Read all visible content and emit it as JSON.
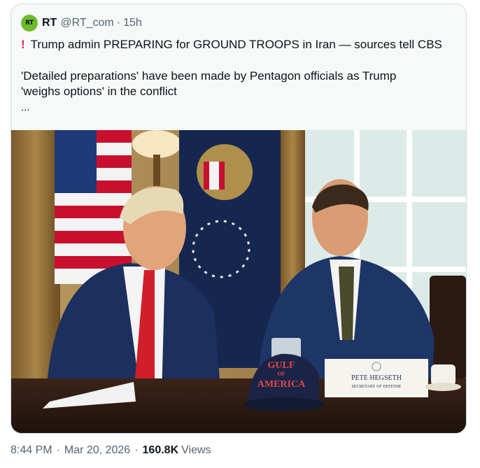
{
  "tweet": {
    "avatar_text": "RT",
    "display_name": "RT",
    "handle": "@RT_com",
    "separator": "·",
    "time_ago": "15h",
    "headline_icon": "exclamation-icon",
    "headline_bang": "!",
    "headline": "Trump admin PREPARING for GROUND TROOPS in Iran — sources tell CBS",
    "body_line1": "'Detailed preparations' have been made by Pentagon officials as Trump",
    "body_line2": "'weighs options' in the conflict",
    "ellipsis": "...",
    "photo": {
      "hat_text_line1": "GULF",
      "hat_text_line2": "OF",
      "hat_text_line3": "AMERICA",
      "placard_name": "PETE HEGSETH",
      "placard_title": "SECRETARY OF DEFENSE"
    }
  },
  "meta": {
    "time": "8:44 PM",
    "separator": "·",
    "date": "Mar 20, 2026",
    "views_count": "160.8K",
    "views_label": "Views"
  },
  "colors": {
    "avatar_green": "#6bbd2b",
    "muted_text": "#536471",
    "border": "#cfd9de",
    "bang_red": "#e0245e"
  }
}
